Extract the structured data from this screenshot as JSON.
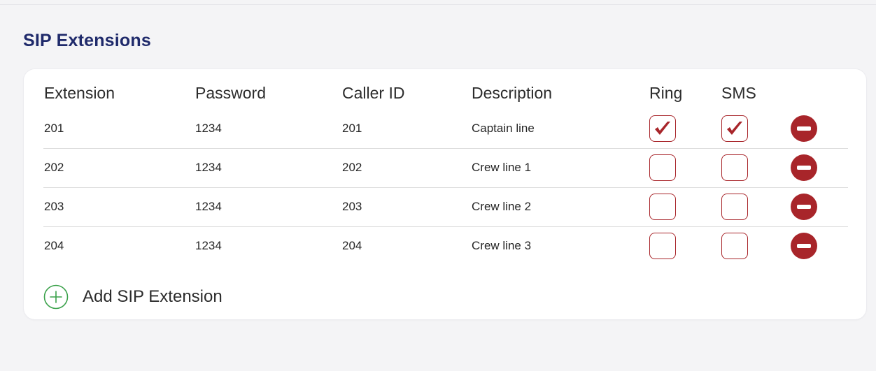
{
  "section": {
    "title": "SIP Extensions"
  },
  "table": {
    "headers": {
      "extension": "Extension",
      "password": "Password",
      "caller_id": "Caller ID",
      "description": "Description",
      "ring": "Ring",
      "sms": "SMS"
    },
    "rows": [
      {
        "extension": "201",
        "password": "1234",
        "caller_id": "201",
        "description": "Captain line",
        "ring": true,
        "sms": true
      },
      {
        "extension": "202",
        "password": "1234",
        "caller_id": "202",
        "description": "Crew line 1",
        "ring": false,
        "sms": false
      },
      {
        "extension": "203",
        "password": "1234",
        "caller_id": "203",
        "description": "Crew line 2",
        "ring": false,
        "sms": false
      },
      {
        "extension": "204",
        "password": "1234",
        "caller_id": "204",
        "description": "Crew line 3",
        "ring": false,
        "sms": false
      }
    ]
  },
  "add_button": {
    "label": "Add SIP Extension",
    "icon": "plus-circle-icon"
  },
  "row_actions": {
    "remove_icon": "remove-icon"
  },
  "colors": {
    "title": "#1f2a6b",
    "accent_red": "#a8252a",
    "add_green": "#3aa14a",
    "divider": "#dcdcdc",
    "page_bg": "#f4f4f6",
    "card_bg": "#ffffff"
  }
}
